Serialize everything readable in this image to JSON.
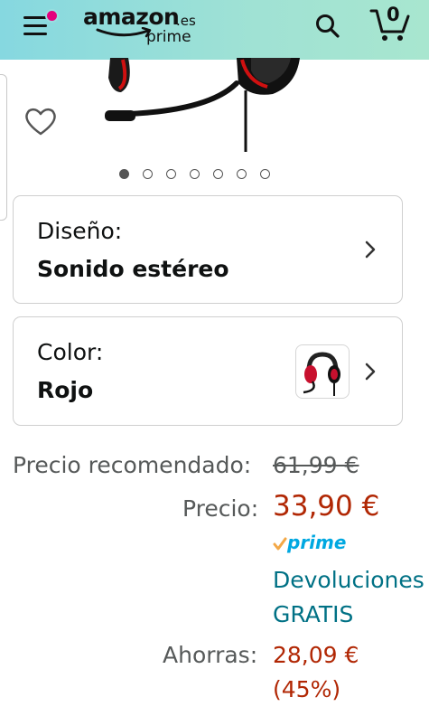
{
  "header": {
    "logo_word": "amazon",
    "logo_tld": ".es",
    "logo_sub": "prime",
    "cart_count": "0"
  },
  "gallery": {
    "total_images": 7,
    "active_index": 0
  },
  "options": {
    "design": {
      "label": "Diseño:",
      "value": "Sonido estéreo"
    },
    "color": {
      "label": "Color:",
      "value": "Rojo"
    }
  },
  "pricing": {
    "recommended_label": "Precio recomendado:",
    "recommended_value": "61,99 €",
    "price_label": "Precio:",
    "price_value": "33,90 €",
    "prime_label": "prime",
    "returns_line1": "Devoluciones",
    "returns_line2": "GRATIS",
    "savings_label": "Ahorras:",
    "savings_value": "28,09 €",
    "savings_percent": "(45%)"
  },
  "colors": {
    "header_start": "#86d8e0",
    "header_end": "#a8e6cf",
    "price_red": "#b12704",
    "link_teal": "#007185",
    "prime_blue": "#00a8e1",
    "notification": "#e4007c"
  }
}
